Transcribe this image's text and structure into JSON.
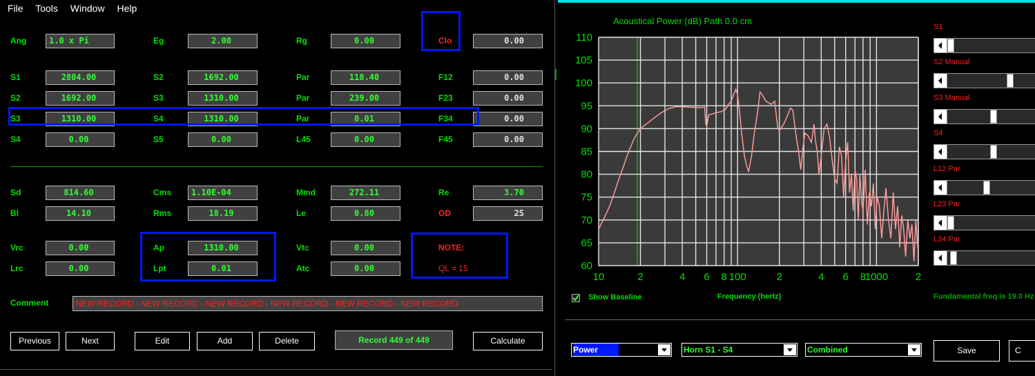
{
  "menu": [
    "File",
    "Tools",
    "Window",
    "Help"
  ],
  "row0": {
    "ang_label": "Ang",
    "ang": "1.0 x Pi",
    "eg_label": "Eg",
    "eg": "2.00",
    "rg_label": "Rg",
    "rg": "0.00",
    "clo_label": "Clo",
    "clo": "0.00"
  },
  "rows": [
    {
      "a_label": "S1",
      "a": "2804.00",
      "b_label": "S2",
      "b": "1692.00",
      "c_label": "Par",
      "c": "118.40",
      "d_label": "F12",
      "d": "0.00"
    },
    {
      "a_label": "S2",
      "a": "1692.00",
      "b_label": "S3",
      "b": "1310.00",
      "c_label": "Par",
      "c": "239.00",
      "d_label": "F23",
      "d": "0.00"
    },
    {
      "a_label": "S3",
      "a": "1310.00",
      "b_label": "S4",
      "b": "1310.00",
      "c_label": "Par",
      "c": "0.01",
      "d_label": "F34",
      "d": "0.00"
    },
    {
      "a_label": "S4",
      "a": "0.00",
      "b_label": "S5",
      "b": "0.00",
      "c_label": "L45",
      "c": "0.00",
      "d_label": "F45",
      "d": "0.00"
    }
  ],
  "driver": {
    "sd_label": "Sd",
    "sd": "814.60",
    "cms_label": "Cms",
    "cms": "1.10E-04",
    "mmd_label": "Mmd",
    "mmd": "272.11",
    "re_label": "Re",
    "re": "3.70",
    "bl_label": "Bl",
    "bl": "14.10",
    "rms_label": "Rms",
    "rms": "18.19",
    "le_label": "Le",
    "le": "0.80",
    "od_label": "OD",
    "od": "2S"
  },
  "chamber": {
    "vrc_label": "Vrc",
    "vrc": "0.00",
    "ap_label": "Ap",
    "ap": "1310.00",
    "vtc_label": "Vtc",
    "vtc": "0.00",
    "note_label": "NOTE:",
    "lrc_label": "Lrc",
    "lrc": "0.00",
    "lpt_label": "Lpt",
    "lpt": "0.01",
    "atc_label": "Atc",
    "atc": "0.00",
    "ql": "QL = 15"
  },
  "comment": {
    "label": "Comment",
    "value": "NEW RECORD - NEW RECORD - NEW RECORD - NEW RECORD - NEW RECORD - NEW RECORD"
  },
  "buttons": {
    "previous": "Previous",
    "next": "Next",
    "edit": "Edit",
    "add": "Add",
    "delete": "Delete",
    "record": "Record 449 of 449",
    "calculate": "Calculate"
  },
  "graph": {
    "title": "Acoustical Power (dB)   Path 0.0 cm",
    "xlabel": "Frequency (hertz)",
    "show_baseline": "Show Baseline",
    "fundamental": "Fundamental freq is 19.0 Hz"
  },
  "sliders": [
    {
      "label": "S1",
      "value": 0.0
    },
    {
      "label": "S2 Manual",
      "value": 0.72
    },
    {
      "label": "S3 Manual",
      "value": 0.52
    },
    {
      "label": "S4",
      "value": 0.52
    },
    {
      "label": "L12 Par",
      "value": 0.43
    },
    {
      "label": "L23 Par",
      "value": 0.0
    },
    {
      "label": "L34 Par",
      "value": 0.03
    }
  ],
  "combos": {
    "plot": "Power",
    "horn": "Horn S1 - S4",
    "mode": "Combined"
  },
  "right_buttons": {
    "save": "Save",
    "c": "C"
  },
  "chart_data": {
    "type": "line",
    "title": "Acoustical Power (dB)   Path 0.0 cm",
    "xlabel": "Frequency (hertz)",
    "ylabel": "",
    "xscale": "log",
    "xlim": [
      10,
      2000
    ],
    "ylim": [
      60,
      110
    ],
    "yticks": [
      60,
      65,
      70,
      75,
      80,
      85,
      90,
      95,
      100,
      105,
      110
    ],
    "xtick_labels": [
      {
        "x": 10,
        "t": "10"
      },
      {
        "x": 20,
        "t": "2"
      },
      {
        "x": 40,
        "t": "4"
      },
      {
        "x": 60,
        "t": "6"
      },
      {
        "x": 80,
        "t": "8"
      },
      {
        "x": 100,
        "t": "100"
      },
      {
        "x": 200,
        "t": "2"
      },
      {
        "x": 400,
        "t": "4"
      },
      {
        "x": 600,
        "t": "6"
      },
      {
        "x": 800,
        "t": "8"
      },
      {
        "x": 1000,
        "t": "1000"
      },
      {
        "x": 2000,
        "t": "2"
      }
    ],
    "grid": true,
    "series": [
      {
        "color": "#ff9a9a",
        "points": [
          [
            10,
            68
          ],
          [
            11,
            70.5
          ],
          [
            12,
            73
          ],
          [
            13,
            76
          ],
          [
            14,
            79
          ],
          [
            15,
            81.5
          ],
          [
            16,
            84
          ],
          [
            17,
            86
          ],
          [
            18,
            87.8
          ],
          [
            19,
            89
          ],
          [
            20,
            90
          ],
          [
            22,
            91
          ],
          [
            25,
            92.3
          ],
          [
            28,
            93.4
          ],
          [
            32,
            94.4
          ],
          [
            36,
            94.8
          ],
          [
            40,
            94.8
          ],
          [
            45,
            94.7
          ],
          [
            50,
            94.6
          ],
          [
            55,
            94.6
          ],
          [
            58,
            94.7
          ],
          [
            59,
            91
          ],
          [
            60,
            90.5
          ],
          [
            62,
            93
          ],
          [
            66,
            93.2
          ],
          [
            70,
            93.5
          ],
          [
            76,
            93.7
          ],
          [
            82,
            94.2
          ],
          [
            86,
            95.3
          ],
          [
            90,
            96
          ],
          [
            93,
            97.2
          ],
          [
            97,
            98.6
          ],
          [
            100,
            97.5
          ],
          [
            104,
            93
          ],
          [
            108,
            88
          ],
          [
            112,
            84
          ],
          [
            116,
            82
          ],
          [
            120,
            80.5
          ],
          [
            126,
            84
          ],
          [
            132,
            89
          ],
          [
            140,
            94
          ],
          [
            145,
            98
          ],
          [
            150,
            97.5
          ],
          [
            160,
            96
          ],
          [
            175,
            95.3
          ],
          [
            185,
            96
          ],
          [
            195,
            90
          ],
          [
            200,
            89.6
          ],
          [
            215,
            91
          ],
          [
            230,
            93
          ],
          [
            240,
            94.5
          ],
          [
            250,
            94
          ],
          [
            265,
            88
          ],
          [
            275,
            85
          ],
          [
            285,
            81
          ],
          [
            295,
            85.5
          ],
          [
            305,
            89
          ],
          [
            320,
            88.5
          ],
          [
            340,
            87
          ],
          [
            355,
            91
          ],
          [
            365,
            87
          ],
          [
            375,
            85
          ],
          [
            385,
            80
          ],
          [
            400,
            84
          ],
          [
            420,
            90
          ],
          [
            440,
            91
          ],
          [
            460,
            88
          ],
          [
            480,
            83
          ],
          [
            500,
            79
          ],
          [
            520,
            78
          ],
          [
            540,
            86
          ],
          [
            560,
            84
          ],
          [
            580,
            75
          ],
          [
            600,
            83
          ],
          [
            620,
            87
          ],
          [
            640,
            76
          ],
          [
            660,
            80
          ],
          [
            680,
            72
          ],
          [
            700,
            81
          ],
          [
            720,
            79
          ],
          [
            740,
            70
          ],
          [
            760,
            80
          ],
          [
            780,
            74
          ],
          [
            800,
            72
          ],
          [
            830,
            81
          ],
          [
            860,
            69
          ],
          [
            890,
            76
          ],
          [
            920,
            73
          ],
          [
            950,
            78
          ],
          [
            980,
            68
          ],
          [
            1010,
            75
          ],
          [
            1050,
            73
          ],
          [
            1090,
            66
          ],
          [
            1130,
            72
          ],
          [
            1170,
            77
          ],
          [
            1220,
            70
          ],
          [
            1270,
            66
          ],
          [
            1320,
            76
          ],
          [
            1370,
            68
          ],
          [
            1420,
            73
          ],
          [
            1470,
            64
          ],
          [
            1520,
            71
          ],
          [
            1570,
            68
          ],
          [
            1620,
            62
          ],
          [
            1680,
            70
          ],
          [
            1740,
            66
          ],
          [
            1800,
            69
          ],
          [
            1860,
            61
          ],
          [
            1920,
            70
          ],
          [
            1980,
            64
          ],
          [
            2000,
            65
          ]
        ]
      }
    ]
  }
}
